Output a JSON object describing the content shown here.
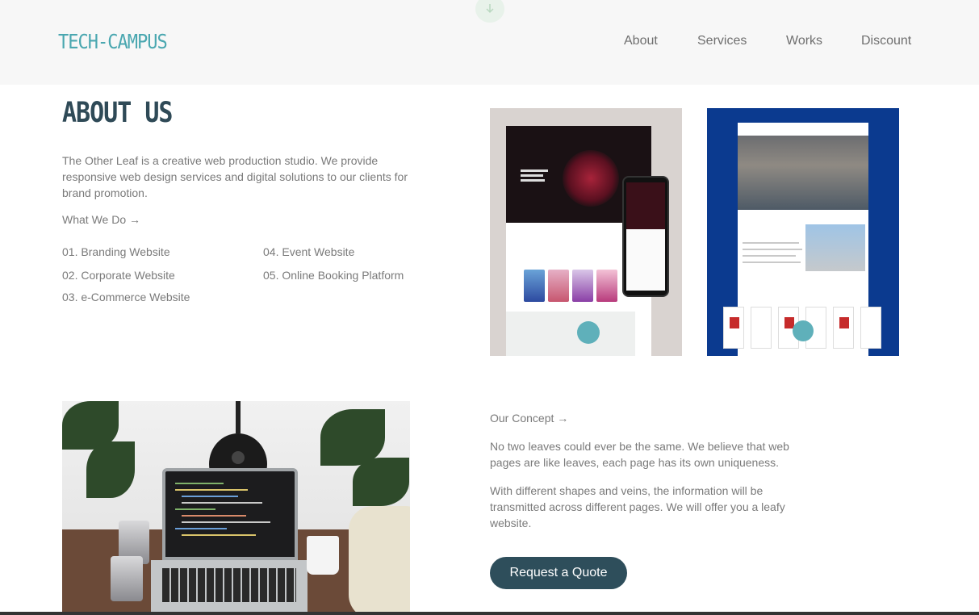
{
  "header": {
    "logo": "TECH-CAMPUS",
    "nav": [
      {
        "label": "About"
      },
      {
        "label": "Services"
      },
      {
        "label": "Works"
      },
      {
        "label": "Discount"
      }
    ]
  },
  "about": {
    "title": "ABOUT US",
    "description": "The Other Leaf is a creative web production studio. We provide responsive web design services and digital solutions to our clients for brand promotion.",
    "what_we_do": "What We Do →",
    "services": [
      "01. Branding Website",
      "02. Corporate Website",
      "03. e-Commerce Website",
      "04. Event Website",
      "05. Online Booking Platform"
    ]
  },
  "concept": {
    "label": "Our Concept →",
    "paragraphs": [
      "No two leaves could ever be the same. We believe that web pages are like leaves, each page has its own uniqueness.",
      "With different shapes and veins, the information will be transmitted across different pages. We will offer you a leafy website."
    ],
    "button": "Request a Quote"
  },
  "colors": {
    "logo": "#4aa7b0",
    "title": "#2f4a57",
    "button_bg": "#2e4e5b",
    "header_bg": "#f7f7f7",
    "portfolio_blue": "#0b3a8f"
  },
  "icons": {
    "scroll_hint": "arrow-down-icon"
  }
}
